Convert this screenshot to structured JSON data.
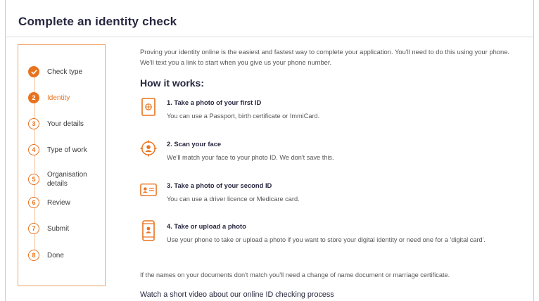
{
  "page": {
    "title": "Complete an identity check"
  },
  "stepper": {
    "steps": [
      {
        "number": "",
        "label": "Check type",
        "state": "done"
      },
      {
        "number": "2",
        "label": "Identity",
        "state": "current"
      },
      {
        "number": "3",
        "label": "Your details",
        "state": "todo"
      },
      {
        "number": "4",
        "label": "Type of work",
        "state": "todo"
      },
      {
        "number": "5",
        "label": "Organisation details",
        "state": "todo"
      },
      {
        "number": "6",
        "label": "Review",
        "state": "todo"
      },
      {
        "number": "7",
        "label": "Submit",
        "state": "todo"
      },
      {
        "number": "8",
        "label": "Done",
        "state": "todo"
      }
    ]
  },
  "main": {
    "intro": "Proving your identity online is the easiest and fastest way to complete your application. You'll need to do this using your phone. We'll text you a link to start when you give us your phone number.",
    "how_heading": "How it works:",
    "items": [
      {
        "icon": "passport-icon",
        "title": "1. Take a photo of your first ID",
        "desc": "You can use a Passport, birth certificate or ImmiCard."
      },
      {
        "icon": "face-scan-icon",
        "title": "2. Scan your face",
        "desc": "We'll match your face to your photo ID. We don't save this."
      },
      {
        "icon": "id-card-icon",
        "title": "3. Take a photo of your second ID",
        "desc": "You can use a driver licence or Medicare card."
      },
      {
        "icon": "phone-icon",
        "title": "4. Take or upload a photo",
        "desc": "Use your phone to take or upload a photo if you want to store your digital identity or need one for a 'digital card'."
      }
    ],
    "note": "If the names on your documents don't match you'll need a change of name document or marriage certificate.",
    "video_link": "Watch a short video about our online ID checking process"
  },
  "colors": {
    "accent": "#e8731f",
    "heading": "#26263f"
  }
}
